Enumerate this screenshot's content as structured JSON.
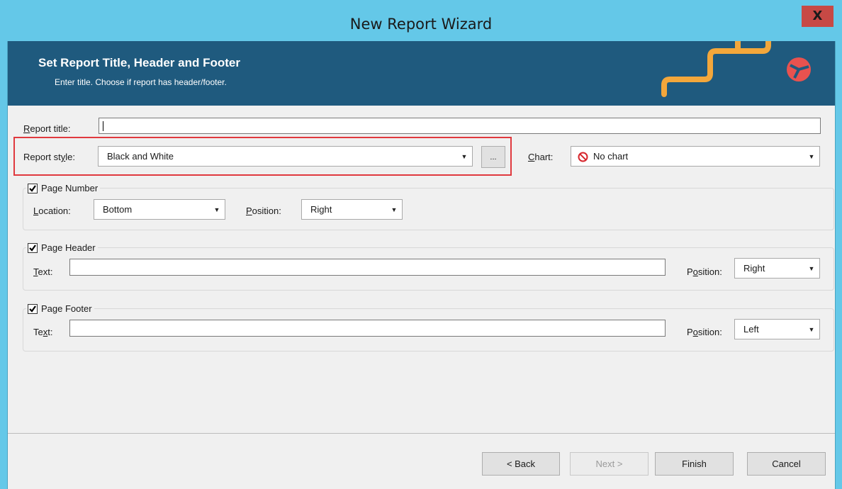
{
  "window": {
    "title": "New Report Wizard",
    "close_label": "X"
  },
  "banner": {
    "title": "Set Report Title, Header and Footer",
    "subtitle": "Enter title.  Choose if report has header/footer.",
    "accent_color": "#f3a73b",
    "logo_color": "#e8524f"
  },
  "form": {
    "report_title_label_u": "R",
    "report_title_label_rest": "eport title:",
    "report_title_value": "",
    "report_style_label_a": "Report st",
    "report_style_label_u": "y",
    "report_style_label_b": "le:",
    "report_style_value": "Black and White",
    "style_browse_label": "...",
    "chart_label_u": "C",
    "chart_label_rest": "hart:",
    "chart_value": "No chart",
    "chart_icon": "no-symbol-icon"
  },
  "page_number": {
    "label": "Page Number",
    "checked": true,
    "location_label_u": "L",
    "location_label_rest": "ocation:",
    "location_value": "Bottom",
    "position_label_u": "P",
    "position_label_rest": "osition:",
    "position_value": "Right"
  },
  "page_header": {
    "label": "Page Header",
    "checked": true,
    "text_label_u": "T",
    "text_label_rest": "ext:",
    "text_value": "",
    "position_label_a": "P",
    "position_label_u": "o",
    "position_label_b": "sition:",
    "position_value": "Right"
  },
  "page_footer": {
    "label": "Page Footer",
    "checked": true,
    "text_label_a": "Te",
    "text_label_u": "x",
    "text_label_b": "t:",
    "text_value": "",
    "position_label_a": "P",
    "position_label_u": "o",
    "position_label_b": "sition:",
    "position_value": "Left"
  },
  "buttons": {
    "back": "< Back",
    "next": "Next >",
    "finish": "Finish",
    "cancel": "Cancel"
  }
}
